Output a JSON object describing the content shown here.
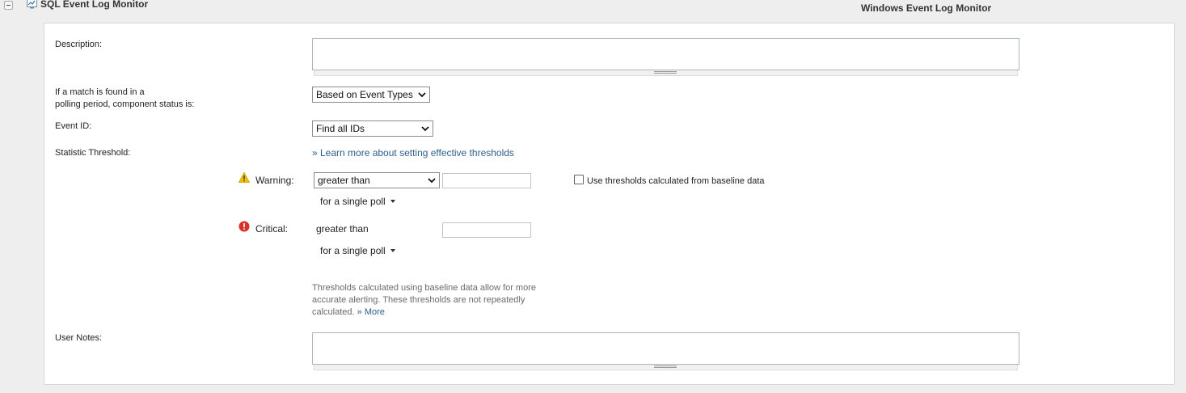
{
  "header": {
    "title": "SQL Event Log Monitor",
    "right_title": "Windows Event Log Monitor"
  },
  "form": {
    "description_label": "Description:",
    "description_value": "",
    "match_label_line1": "If a match is found in a",
    "match_label_line2": "polling period, component status is:",
    "match_select": "Based on Event Types",
    "event_id_label": "Event ID:",
    "event_id_select": "Find all IDs",
    "statistic_label": "Statistic Threshold:",
    "learn_more_link": "» Learn more about setting effective thresholds",
    "warning": {
      "label": "Warning:",
      "operator": "greater than",
      "value": "",
      "poll": "for  a single poll"
    },
    "baseline_checkbox_label": "Use thresholds calculated from baseline data",
    "baseline_checked": false,
    "critical": {
      "label": "Critical:",
      "operator": "greater than",
      "value": "",
      "poll": "for  a single poll"
    },
    "help_text": "Thresholds calculated using baseline data allow for more accurate alerting. These thresholds are not repeatedly calculated.",
    "help_more": "» More",
    "user_notes_label": "User Notes:",
    "user_notes_value": ""
  },
  "icons": {
    "collapse": "minus-collapse-icon",
    "monitor": "monitor-chart-icon",
    "warning": "warning-triangle-icon",
    "critical": "critical-error-icon",
    "dropdown": "chevron-down-icon",
    "menu": "caret-down-icon"
  },
  "colors": {
    "link": "#2f5e8c",
    "warning": "#f2c200",
    "critical": "#d9302c"
  }
}
